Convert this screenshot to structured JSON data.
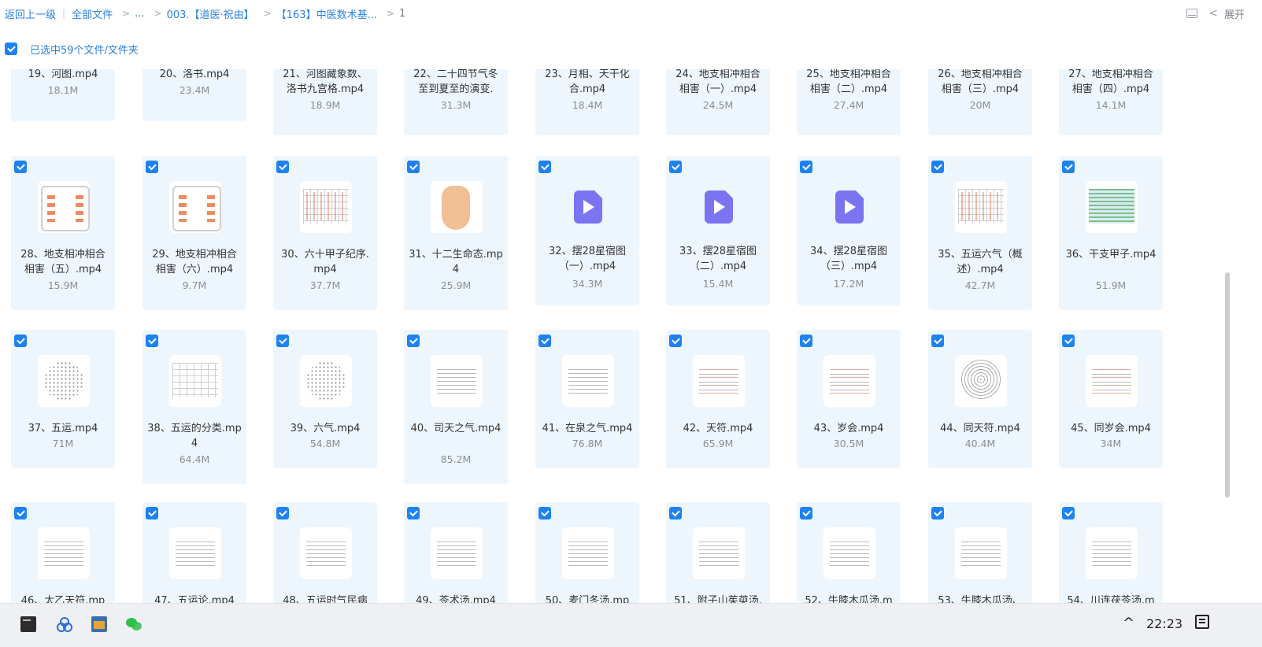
{
  "breadcrumb": {
    "back": "返回上一级",
    "all_files": "全部文件",
    "ellipsis": "...",
    "folder1": "003.【道医·祝由】",
    "folder2": "【163】中医数术基...",
    "current": "1"
  },
  "topright": {
    "expand": "展开"
  },
  "selection": {
    "text": "已选中59个文件/文件夹"
  },
  "rows": [
    {
      "partial": true,
      "items": [
        {
          "name": "19、河图.mp4",
          "size": "18.1M",
          "lines": 1
        },
        {
          "name": "20、洛书.mp4",
          "size": "23.4M",
          "lines": 1
        },
        {
          "name": "21、河图藏象数、洛书九宫格.mp4",
          "size": "18.9M",
          "lines": 2
        },
        {
          "name": "22、二十四节气冬至到夏至的演变.",
          "size": "31.3M",
          "lines": 2
        },
        {
          "name": "23、月相、天干化合.mp4",
          "size": "18.4M",
          "lines": 2
        },
        {
          "name": "24、地支相冲相合相害（一）.mp4",
          "size": "24.5M",
          "lines": 2
        },
        {
          "name": "25、地支相冲相合相害（二）.mp4",
          "size": "27.4M",
          "lines": 2
        },
        {
          "name": "26、地支相冲相合相害（三）.mp4",
          "size": "20M",
          "lines": 2
        },
        {
          "name": "27、地支相冲相合相害（四）.mp4",
          "size": "14.1M",
          "lines": 2
        }
      ]
    },
    {
      "items": [
        {
          "name": "28、地支相冲相合相害（五）.mp4",
          "size": "15.9M",
          "thumb": "orbit"
        },
        {
          "name": "29、地支相冲相合相害（六）.mp4",
          "size": "9.7M",
          "thumb": "orbit"
        },
        {
          "name": "30、六十甲子纪序.mp4",
          "size": "37.7M",
          "thumb": "table-red"
        },
        {
          "name": "31、十二生命态.mp4",
          "size": "25.9M",
          "thumb": "hand"
        },
        {
          "name": "32、摆28星宿图（一）.mp4",
          "size": "34.3M",
          "thumb": "video"
        },
        {
          "name": "33、摆28星宿图（二）.mp4",
          "size": "15.4M",
          "thumb": "video"
        },
        {
          "name": "34、摆28星宿图（三）.mp4",
          "size": "17.2M",
          "thumb": "video"
        },
        {
          "name": "35、五运六气（概述）.mp4",
          "size": "42.7M",
          "thumb": "table-red"
        },
        {
          "name": "36、干支甲子.mp4",
          "size": "51.9M",
          "thumb": "table-green"
        }
      ]
    },
    {
      "items": [
        {
          "name": "37、五运.mp4",
          "size": "71M",
          "thumb": "dots"
        },
        {
          "name": "38、五运的分类.mp4",
          "size": "64.4M",
          "thumb": "table"
        },
        {
          "name": "39、六气.mp4",
          "size": "54.8M",
          "thumb": "dots"
        },
        {
          "name": "40、司天之气.mp4",
          "size": "85.2M",
          "thumb": "lines"
        },
        {
          "name": "41、在泉之气.mp4",
          "size": "76.8M",
          "thumb": "lines"
        },
        {
          "name": "42、天符.mp4",
          "size": "65.9M",
          "thumb": "lines-red"
        },
        {
          "name": "43、岁会.mp4",
          "size": "30.5M",
          "thumb": "lines-red"
        },
        {
          "name": "44、同天符.mp4",
          "size": "40.4M",
          "thumb": "circ"
        },
        {
          "name": "45、同岁会.mp4",
          "size": "34M",
          "thumb": "lines-red"
        }
      ]
    },
    {
      "partial_bottom": true,
      "items": [
        {
          "name": "46、太乙天符.mp",
          "size": "",
          "thumb": "lines"
        },
        {
          "name": "47、五运论.mp4",
          "size": "",
          "thumb": "lines"
        },
        {
          "name": "48、五运时气民病",
          "size": "",
          "thumb": "lines"
        },
        {
          "name": "49、苓术汤.mp4",
          "size": "",
          "thumb": "lines"
        },
        {
          "name": "50、麦门冬汤.mp",
          "size": "",
          "thumb": "lines"
        },
        {
          "name": "51、附子山茱萸汤.",
          "size": "",
          "thumb": "lines"
        },
        {
          "name": "52、牛膝木瓜汤.m",
          "size": "",
          "thumb": "lines"
        },
        {
          "name": "53、牛膝木瓜汤、",
          "size": "",
          "thumb": "lines"
        },
        {
          "name": "54、川连茯苓汤.m",
          "size": "",
          "thumb": "lines"
        }
      ]
    }
  ],
  "taskbar": {
    "time": "22:23"
  },
  "colors": {
    "accent": "#1e82f0",
    "tile_bg": "#eef6fd",
    "video_icon": "#7b74f0"
  }
}
